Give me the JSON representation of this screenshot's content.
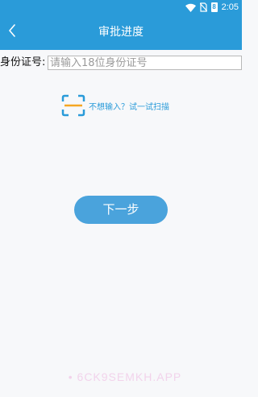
{
  "status_bar": {
    "time": "2:05",
    "battery_level": "8"
  },
  "header": {
    "title": "审批进度"
  },
  "form": {
    "id_label": "身份证号:",
    "id_placeholder": "请输入18位身份证号",
    "id_value": ""
  },
  "scan": {
    "text": "不想输入？试一试扫描",
    "icon": "scan-frame-icon"
  },
  "actions": {
    "next_label": "下一步"
  },
  "watermark": {
    "text": "6CK9SEMKH.APP"
  },
  "colors": {
    "primary": "#2a9bd9",
    "button": "#4aa3dc",
    "background": "#f7f8fa",
    "scan_accent": "#f5a623"
  }
}
